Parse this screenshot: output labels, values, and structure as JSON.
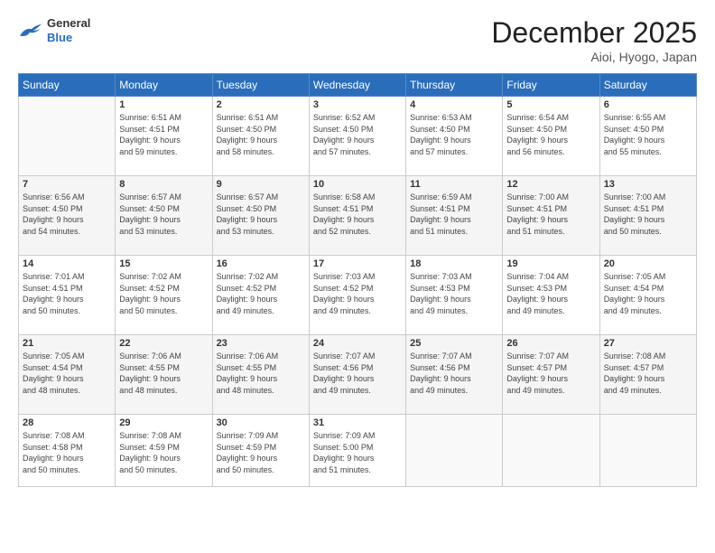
{
  "header": {
    "logo": {
      "general": "General",
      "blue": "Blue"
    },
    "title": "December 2025",
    "location": "Aioi, Hyogo, Japan"
  },
  "weekdays": [
    "Sunday",
    "Monday",
    "Tuesday",
    "Wednesday",
    "Thursday",
    "Friday",
    "Saturday"
  ],
  "weeks": [
    [
      {
        "day": "",
        "info": ""
      },
      {
        "day": "1",
        "info": "Sunrise: 6:51 AM\nSunset: 4:51 PM\nDaylight: 9 hours\nand 59 minutes."
      },
      {
        "day": "2",
        "info": "Sunrise: 6:51 AM\nSunset: 4:50 PM\nDaylight: 9 hours\nand 58 minutes."
      },
      {
        "day": "3",
        "info": "Sunrise: 6:52 AM\nSunset: 4:50 PM\nDaylight: 9 hours\nand 57 minutes."
      },
      {
        "day": "4",
        "info": "Sunrise: 6:53 AM\nSunset: 4:50 PM\nDaylight: 9 hours\nand 57 minutes."
      },
      {
        "day": "5",
        "info": "Sunrise: 6:54 AM\nSunset: 4:50 PM\nDaylight: 9 hours\nand 56 minutes."
      },
      {
        "day": "6",
        "info": "Sunrise: 6:55 AM\nSunset: 4:50 PM\nDaylight: 9 hours\nand 55 minutes."
      }
    ],
    [
      {
        "day": "7",
        "info": "Sunrise: 6:56 AM\nSunset: 4:50 PM\nDaylight: 9 hours\nand 54 minutes."
      },
      {
        "day": "8",
        "info": "Sunrise: 6:57 AM\nSunset: 4:50 PM\nDaylight: 9 hours\nand 53 minutes."
      },
      {
        "day": "9",
        "info": "Sunrise: 6:57 AM\nSunset: 4:50 PM\nDaylight: 9 hours\nand 53 minutes."
      },
      {
        "day": "10",
        "info": "Sunrise: 6:58 AM\nSunset: 4:51 PM\nDaylight: 9 hours\nand 52 minutes."
      },
      {
        "day": "11",
        "info": "Sunrise: 6:59 AM\nSunset: 4:51 PM\nDaylight: 9 hours\nand 51 minutes."
      },
      {
        "day": "12",
        "info": "Sunrise: 7:00 AM\nSunset: 4:51 PM\nDaylight: 9 hours\nand 51 minutes."
      },
      {
        "day": "13",
        "info": "Sunrise: 7:00 AM\nSunset: 4:51 PM\nDaylight: 9 hours\nand 50 minutes."
      }
    ],
    [
      {
        "day": "14",
        "info": "Sunrise: 7:01 AM\nSunset: 4:51 PM\nDaylight: 9 hours\nand 50 minutes."
      },
      {
        "day": "15",
        "info": "Sunrise: 7:02 AM\nSunset: 4:52 PM\nDaylight: 9 hours\nand 50 minutes."
      },
      {
        "day": "16",
        "info": "Sunrise: 7:02 AM\nSunset: 4:52 PM\nDaylight: 9 hours\nand 49 minutes."
      },
      {
        "day": "17",
        "info": "Sunrise: 7:03 AM\nSunset: 4:52 PM\nDaylight: 9 hours\nand 49 minutes."
      },
      {
        "day": "18",
        "info": "Sunrise: 7:03 AM\nSunset: 4:53 PM\nDaylight: 9 hours\nand 49 minutes."
      },
      {
        "day": "19",
        "info": "Sunrise: 7:04 AM\nSunset: 4:53 PM\nDaylight: 9 hours\nand 49 minutes."
      },
      {
        "day": "20",
        "info": "Sunrise: 7:05 AM\nSunset: 4:54 PM\nDaylight: 9 hours\nand 49 minutes."
      }
    ],
    [
      {
        "day": "21",
        "info": "Sunrise: 7:05 AM\nSunset: 4:54 PM\nDaylight: 9 hours\nand 48 minutes."
      },
      {
        "day": "22",
        "info": "Sunrise: 7:06 AM\nSunset: 4:55 PM\nDaylight: 9 hours\nand 48 minutes."
      },
      {
        "day": "23",
        "info": "Sunrise: 7:06 AM\nSunset: 4:55 PM\nDaylight: 9 hours\nand 48 minutes."
      },
      {
        "day": "24",
        "info": "Sunrise: 7:07 AM\nSunset: 4:56 PM\nDaylight: 9 hours\nand 49 minutes."
      },
      {
        "day": "25",
        "info": "Sunrise: 7:07 AM\nSunset: 4:56 PM\nDaylight: 9 hours\nand 49 minutes."
      },
      {
        "day": "26",
        "info": "Sunrise: 7:07 AM\nSunset: 4:57 PM\nDaylight: 9 hours\nand 49 minutes."
      },
      {
        "day": "27",
        "info": "Sunrise: 7:08 AM\nSunset: 4:57 PM\nDaylight: 9 hours\nand 49 minutes."
      }
    ],
    [
      {
        "day": "28",
        "info": "Sunrise: 7:08 AM\nSunset: 4:58 PM\nDaylight: 9 hours\nand 50 minutes."
      },
      {
        "day": "29",
        "info": "Sunrise: 7:08 AM\nSunset: 4:59 PM\nDaylight: 9 hours\nand 50 minutes."
      },
      {
        "day": "30",
        "info": "Sunrise: 7:09 AM\nSunset: 4:59 PM\nDaylight: 9 hours\nand 50 minutes."
      },
      {
        "day": "31",
        "info": "Sunrise: 7:09 AM\nSunset: 5:00 PM\nDaylight: 9 hours\nand 51 minutes."
      },
      {
        "day": "",
        "info": ""
      },
      {
        "day": "",
        "info": ""
      },
      {
        "day": "",
        "info": ""
      }
    ]
  ]
}
